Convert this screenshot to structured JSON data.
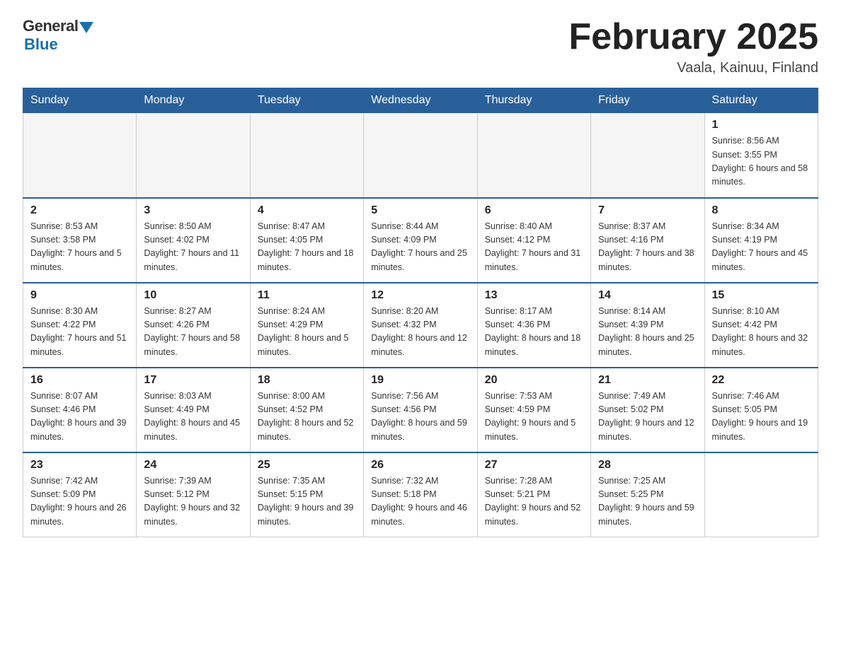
{
  "logo": {
    "general": "General",
    "blue": "Blue"
  },
  "title": "February 2025",
  "location": "Vaala, Kainuu, Finland",
  "days_of_week": [
    "Sunday",
    "Monday",
    "Tuesday",
    "Wednesday",
    "Thursday",
    "Friday",
    "Saturday"
  ],
  "weeks": [
    [
      null,
      null,
      null,
      null,
      null,
      null,
      {
        "day": "1",
        "sunrise": "Sunrise: 8:56 AM",
        "sunset": "Sunset: 3:55 PM",
        "daylight": "Daylight: 6 hours and 58 minutes."
      }
    ],
    [
      {
        "day": "2",
        "sunrise": "Sunrise: 8:53 AM",
        "sunset": "Sunset: 3:58 PM",
        "daylight": "Daylight: 7 hours and 5 minutes."
      },
      {
        "day": "3",
        "sunrise": "Sunrise: 8:50 AM",
        "sunset": "Sunset: 4:02 PM",
        "daylight": "Daylight: 7 hours and 11 minutes."
      },
      {
        "day": "4",
        "sunrise": "Sunrise: 8:47 AM",
        "sunset": "Sunset: 4:05 PM",
        "daylight": "Daylight: 7 hours and 18 minutes."
      },
      {
        "day": "5",
        "sunrise": "Sunrise: 8:44 AM",
        "sunset": "Sunset: 4:09 PM",
        "daylight": "Daylight: 7 hours and 25 minutes."
      },
      {
        "day": "6",
        "sunrise": "Sunrise: 8:40 AM",
        "sunset": "Sunset: 4:12 PM",
        "daylight": "Daylight: 7 hours and 31 minutes."
      },
      {
        "day": "7",
        "sunrise": "Sunrise: 8:37 AM",
        "sunset": "Sunset: 4:16 PM",
        "daylight": "Daylight: 7 hours and 38 minutes."
      },
      {
        "day": "8",
        "sunrise": "Sunrise: 8:34 AM",
        "sunset": "Sunset: 4:19 PM",
        "daylight": "Daylight: 7 hours and 45 minutes."
      }
    ],
    [
      {
        "day": "9",
        "sunrise": "Sunrise: 8:30 AM",
        "sunset": "Sunset: 4:22 PM",
        "daylight": "Daylight: 7 hours and 51 minutes."
      },
      {
        "day": "10",
        "sunrise": "Sunrise: 8:27 AM",
        "sunset": "Sunset: 4:26 PM",
        "daylight": "Daylight: 7 hours and 58 minutes."
      },
      {
        "day": "11",
        "sunrise": "Sunrise: 8:24 AM",
        "sunset": "Sunset: 4:29 PM",
        "daylight": "Daylight: 8 hours and 5 minutes."
      },
      {
        "day": "12",
        "sunrise": "Sunrise: 8:20 AM",
        "sunset": "Sunset: 4:32 PM",
        "daylight": "Daylight: 8 hours and 12 minutes."
      },
      {
        "day": "13",
        "sunrise": "Sunrise: 8:17 AM",
        "sunset": "Sunset: 4:36 PM",
        "daylight": "Daylight: 8 hours and 18 minutes."
      },
      {
        "day": "14",
        "sunrise": "Sunrise: 8:14 AM",
        "sunset": "Sunset: 4:39 PM",
        "daylight": "Daylight: 8 hours and 25 minutes."
      },
      {
        "day": "15",
        "sunrise": "Sunrise: 8:10 AM",
        "sunset": "Sunset: 4:42 PM",
        "daylight": "Daylight: 8 hours and 32 minutes."
      }
    ],
    [
      {
        "day": "16",
        "sunrise": "Sunrise: 8:07 AM",
        "sunset": "Sunset: 4:46 PM",
        "daylight": "Daylight: 8 hours and 39 minutes."
      },
      {
        "day": "17",
        "sunrise": "Sunrise: 8:03 AM",
        "sunset": "Sunset: 4:49 PM",
        "daylight": "Daylight: 8 hours and 45 minutes."
      },
      {
        "day": "18",
        "sunrise": "Sunrise: 8:00 AM",
        "sunset": "Sunset: 4:52 PM",
        "daylight": "Daylight: 8 hours and 52 minutes."
      },
      {
        "day": "19",
        "sunrise": "Sunrise: 7:56 AM",
        "sunset": "Sunset: 4:56 PM",
        "daylight": "Daylight: 8 hours and 59 minutes."
      },
      {
        "day": "20",
        "sunrise": "Sunrise: 7:53 AM",
        "sunset": "Sunset: 4:59 PM",
        "daylight": "Daylight: 9 hours and 5 minutes."
      },
      {
        "day": "21",
        "sunrise": "Sunrise: 7:49 AM",
        "sunset": "Sunset: 5:02 PM",
        "daylight": "Daylight: 9 hours and 12 minutes."
      },
      {
        "day": "22",
        "sunrise": "Sunrise: 7:46 AM",
        "sunset": "Sunset: 5:05 PM",
        "daylight": "Daylight: 9 hours and 19 minutes."
      }
    ],
    [
      {
        "day": "23",
        "sunrise": "Sunrise: 7:42 AM",
        "sunset": "Sunset: 5:09 PM",
        "daylight": "Daylight: 9 hours and 26 minutes."
      },
      {
        "day": "24",
        "sunrise": "Sunrise: 7:39 AM",
        "sunset": "Sunset: 5:12 PM",
        "daylight": "Daylight: 9 hours and 32 minutes."
      },
      {
        "day": "25",
        "sunrise": "Sunrise: 7:35 AM",
        "sunset": "Sunset: 5:15 PM",
        "daylight": "Daylight: 9 hours and 39 minutes."
      },
      {
        "day": "26",
        "sunrise": "Sunrise: 7:32 AM",
        "sunset": "Sunset: 5:18 PM",
        "daylight": "Daylight: 9 hours and 46 minutes."
      },
      {
        "day": "27",
        "sunrise": "Sunrise: 7:28 AM",
        "sunset": "Sunset: 5:21 PM",
        "daylight": "Daylight: 9 hours and 52 minutes."
      },
      {
        "day": "28",
        "sunrise": "Sunrise: 7:25 AM",
        "sunset": "Sunset: 5:25 PM",
        "daylight": "Daylight: 9 hours and 59 minutes."
      },
      null
    ]
  ]
}
